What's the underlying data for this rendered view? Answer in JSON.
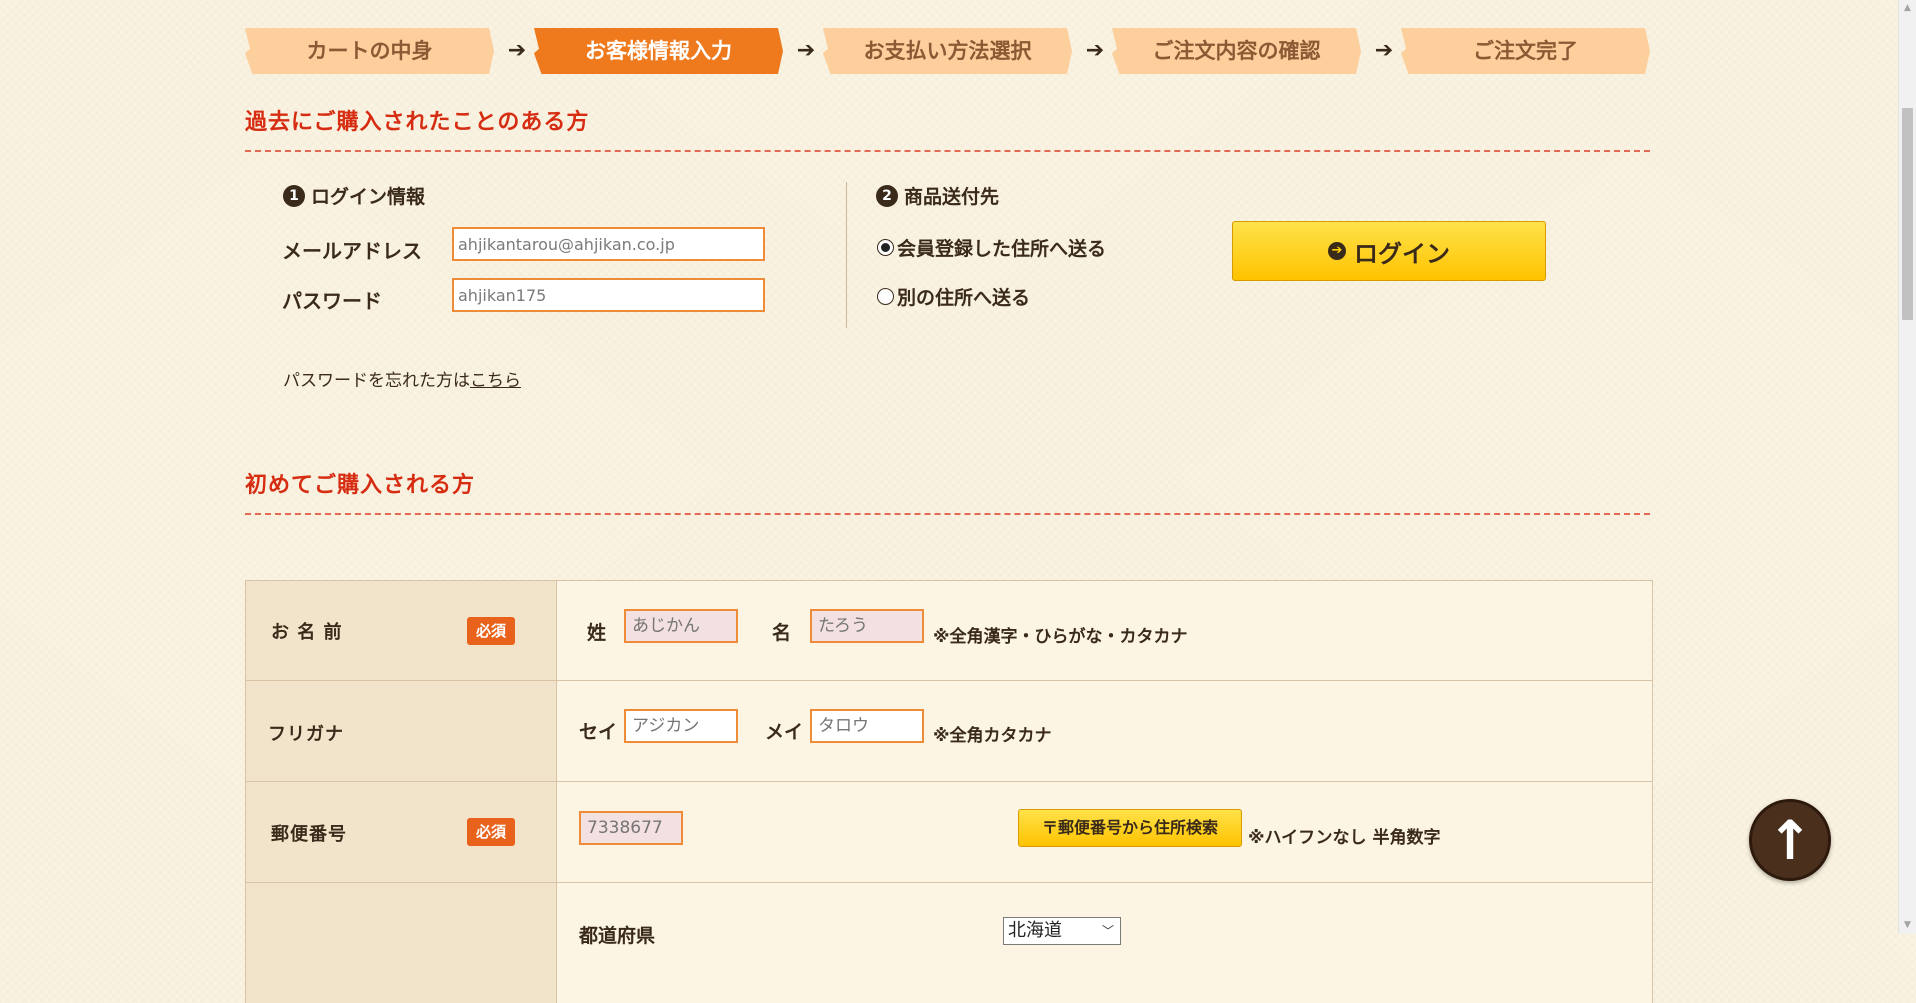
{
  "steps": {
    "items": [
      "カートの中身",
      "お客様情報入力",
      "お支払い方法選択",
      "ご注文内容の確認",
      "ご注文完了"
    ],
    "arrow": "➔",
    "active_index": 1
  },
  "returning": {
    "title": "過去にご購入されたことのある方",
    "login_info": {
      "num": "1",
      "heading": "ログイン情報"
    },
    "email_label": "メールアドレス",
    "email_value": "ahjikantarou@ahjikan.co.jp",
    "password_label": "パスワード",
    "password_value": "ahjikan175",
    "shipping": {
      "num": "2",
      "heading": "商品送付先"
    },
    "radio_registered": "会員登録した住所へ送る",
    "radio_other": "別の住所へ送る",
    "login_button": "ログイン",
    "forgot_text": "パスワードを忘れた方は",
    "forgot_link": "こちら"
  },
  "first_time": {
    "title": "初めてご購入される方"
  },
  "form": {
    "required_badge": "必須",
    "name": {
      "label": "お 名 前",
      "sei_label": "姓",
      "sei_placeholder": "あじかん",
      "mei_label": "名",
      "mei_placeholder": "たろう",
      "note": "※全角漢字・ひらがな・カタカナ"
    },
    "furigana": {
      "label": "フリガナ",
      "sei_label": "セイ",
      "sei_placeholder": "アジカン",
      "mei_label": "メイ",
      "mei_placeholder": "タロウ",
      "note": "※全角カタカナ"
    },
    "postal": {
      "label": "郵便番号",
      "placeholder": "7338677",
      "search_button": "〒郵便番号から住所検索",
      "note": "※ハイフンなし 半角数字"
    },
    "prefecture": {
      "label": "都道府県",
      "selected": "北海道"
    }
  },
  "colors": {
    "accent": "#ef7a1e",
    "heading_red": "#d62d12",
    "button_yellow": "#ffc300"
  }
}
